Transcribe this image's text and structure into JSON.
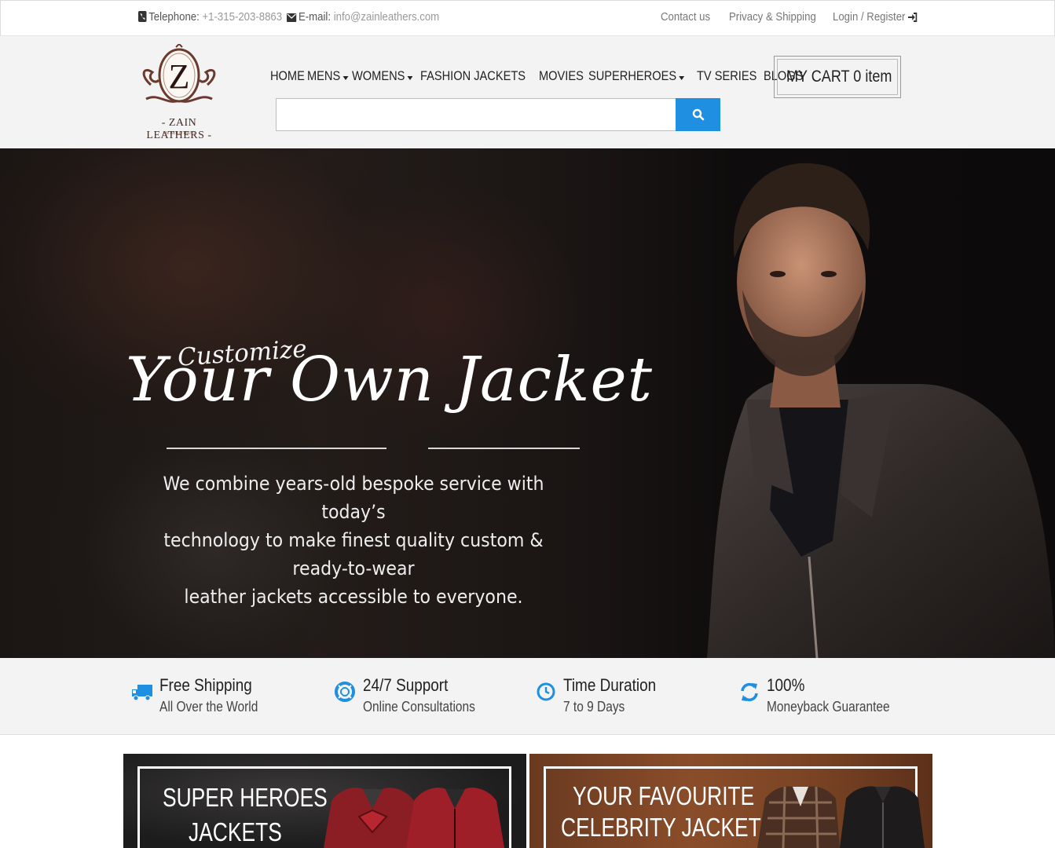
{
  "topbar": {
    "telephone_label": "Telephone:",
    "telephone_value": "+1-315-203-8863",
    "email_label": "E-mail:",
    "email_value": "info@zainleathers.com",
    "contact": "Contact us",
    "privacy": "Privacy & Shipping",
    "login": "Login / Register"
  },
  "logo": {
    "letter": "Z",
    "name": "- ZAIN LEATHERS -",
    "tagline": "WE BUILD TRUST"
  },
  "nav": {
    "items": [
      {
        "label": "HOME"
      },
      {
        "label": "MENS"
      },
      {
        "label": "WOMENS"
      },
      {
        "label": "FASHION JACKETS"
      },
      {
        "label": "MOVIES"
      },
      {
        "label": "SUPERHEROES"
      },
      {
        "label": "TV SERIES"
      },
      {
        "label": "BLOGS"
      }
    ]
  },
  "search": {
    "placeholder": ""
  },
  "cart": {
    "label": "MY CART",
    "count": "0 item"
  },
  "hero": {
    "script_small": "Customize",
    "script_big": "Your Own Jacket",
    "copy": [
      "We combine years-old bespoke service with today’s",
      "technology to make finest quality custom & ready-to-wear",
      "leather jackets accessible to everyone."
    ]
  },
  "features": [
    {
      "title": "Free Shipping",
      "subtitle": "All Over the World",
      "icon": "truck-icon"
    },
    {
      "title": "24/7 Support",
      "subtitle": "Online Consultations",
      "icon": "lifebuoy-icon"
    },
    {
      "title": "Time Duration",
      "subtitle": "7 to 9 Days",
      "icon": "clock-icon"
    },
    {
      "title": "100%",
      "subtitle": "Moneyback Guarantee",
      "icon": "refresh-icon"
    }
  ],
  "promos": [
    {
      "line1": "SUPER HEROES",
      "line2": "JACKETS"
    },
    {
      "line1": "YOUR FAVOURITE",
      "line2": "CELEBRITY JACKETS"
    }
  ],
  "colors": {
    "accent": "#1e8fe1",
    "header_bg": "#f3f3f3"
  }
}
